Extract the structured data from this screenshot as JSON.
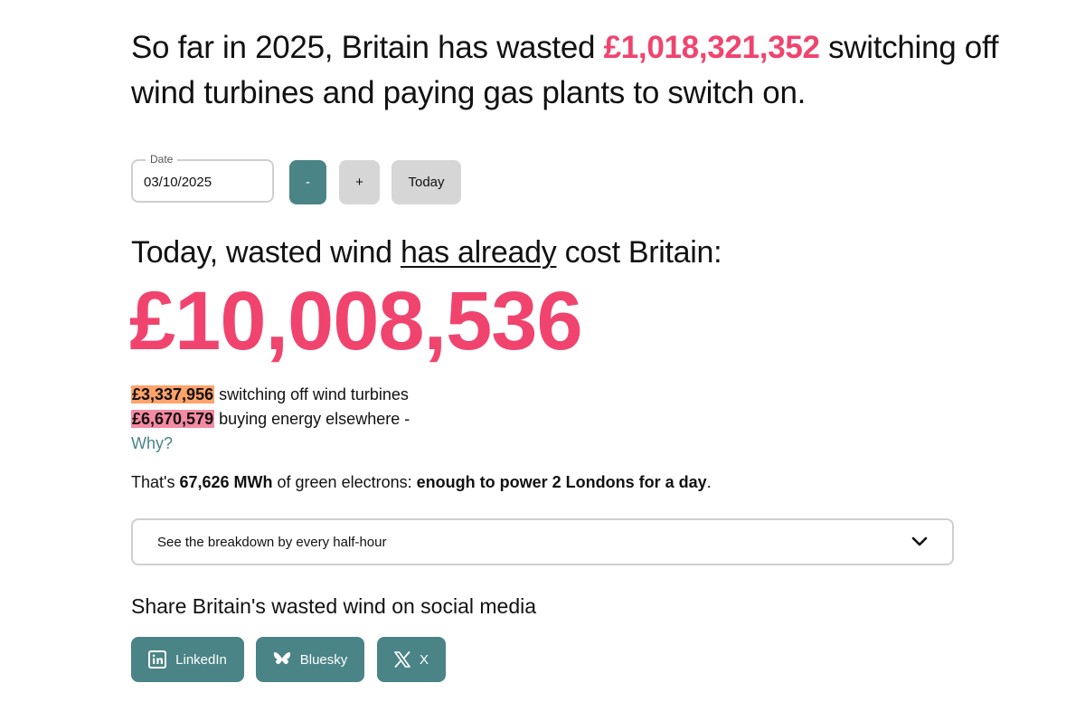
{
  "headline": {
    "prefix": "So far in 2025, Britain has wasted ",
    "amount": "£1,018,321,352",
    "suffix": " switching off wind turbines and paying gas plants to switch on."
  },
  "date_picker": {
    "label": "Date",
    "value": "03/10/2025",
    "minus_label": "-",
    "plus_label": "+",
    "today_label": "Today"
  },
  "today": {
    "prefix": "Today, wasted wind ",
    "emphasis": "has already",
    "suffix": " cost Britain:",
    "total": "£10,008,536"
  },
  "breakdown": {
    "curtailment_amount": "£3,337,956",
    "curtailment_label": " switching off wind turbines",
    "replacement_amount": "£6,670,579",
    "replacement_label": " buying energy elsewhere -",
    "why_link": "Why?"
  },
  "summary": {
    "prefix": "That's ",
    "energy": "67,626 MWh",
    "middle": " of green electrons: ",
    "comparison": "enough to power 2 Londons for a day",
    "suffix": "."
  },
  "accordion": {
    "label": "See the breakdown by every half-hour",
    "icon": "chevron-down-icon"
  },
  "share": {
    "title": "Share Britain's wasted wind on social media",
    "buttons": [
      {
        "label": "LinkedIn",
        "icon": "linkedin-icon"
      },
      {
        "label": "Bluesky",
        "icon": "bluesky-icon"
      },
      {
        "label": "X",
        "icon": "x-icon"
      }
    ]
  },
  "colors": {
    "accent_pink": "#f0446e",
    "teal": "#4a8486",
    "highlight_orange": "#ffa36b",
    "highlight_pink": "#f58aa3",
    "button_grey": "#d6d6d6"
  }
}
